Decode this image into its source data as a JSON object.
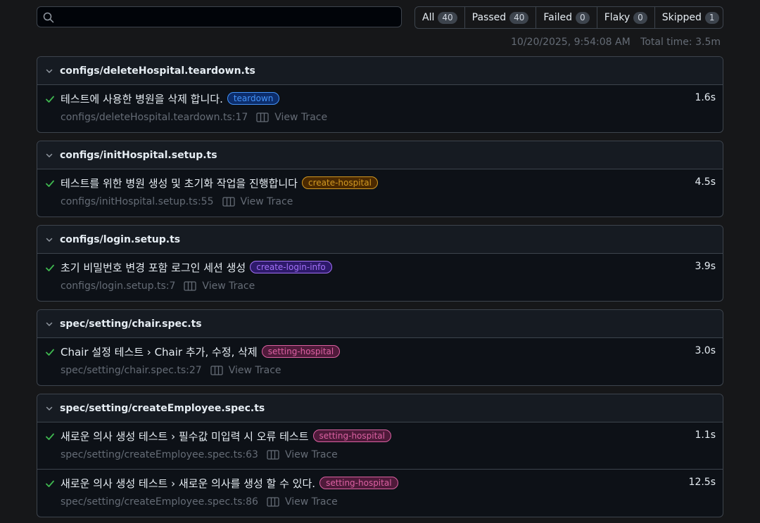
{
  "search": {
    "placeholder": ""
  },
  "filters": [
    {
      "label": "All",
      "count": "40"
    },
    {
      "label": "Passed",
      "count": "40"
    },
    {
      "label": "Failed",
      "count": "0"
    },
    {
      "label": "Flaky",
      "count": "0"
    },
    {
      "label": "Skipped",
      "count": "1"
    }
  ],
  "meta": {
    "datetime": "10/20/2025, 9:54:08 AM",
    "total_time": "Total time: 3.5m"
  },
  "view_trace_label": "View Trace",
  "files": [
    {
      "name": "configs/deleteHospital.teardown.ts",
      "tests": [
        {
          "title": "테스트에 사용한 병원을 삭제 합니다.",
          "label": "teardown",
          "label_color": "#4493f8",
          "label_bg": "#0c2d6b",
          "duration": "1.6s",
          "location": "configs/deleteHospital.teardown.ts:17"
        }
      ]
    },
    {
      "name": "configs/initHospital.setup.ts",
      "tests": [
        {
          "title": "테스트를 위한 병원 생성 및 초기화 작업을 진행합니다",
          "label": "create-hospital",
          "label_color": "#d29922",
          "label_bg": "#4b2900",
          "duration": "4.5s",
          "location": "configs/initHospital.setup.ts:55"
        }
      ]
    },
    {
      "name": "configs/login.setup.ts",
      "tests": [
        {
          "title": "초기 비밀번호 변경 포함 로그인 세션 생성",
          "label": "create-login-info",
          "label_color": "#a371f7",
          "label_bg": "#2e1a6b",
          "duration": "3.9s",
          "location": "configs/login.setup.ts:7"
        }
      ]
    },
    {
      "name": "spec/setting/chair.spec.ts",
      "tests": [
        {
          "title": "Chair 설정 테스트 › Chair 추가, 수정, 삭제",
          "label": "setting-hospital",
          "label_color": "#db61a2",
          "label_bg": "#4f1a3a",
          "duration": "3.0s",
          "location": "spec/setting/chair.spec.ts:27"
        }
      ]
    },
    {
      "name": "spec/setting/createEmployee.spec.ts",
      "tests": [
        {
          "title": "새로운 의사 생성 테스트 › 필수값 미입력 시 오류 테스트",
          "label": "setting-hospital",
          "label_color": "#db61a2",
          "label_bg": "#4f1a3a",
          "duration": "1.1s",
          "location": "spec/setting/createEmployee.spec.ts:63"
        },
        {
          "title": "새로운 의사 생성 테스트 › 새로운 의사를 생성 할 수 있다.",
          "label": "setting-hospital",
          "label_color": "#db61a2",
          "label_bg": "#4f1a3a",
          "duration": "12.5s",
          "location": "spec/setting/createEmployee.spec.ts:86"
        }
      ]
    }
  ],
  "icons": {
    "search": "search-icon",
    "chevron": "chevron-down-icon",
    "check": "check-icon",
    "trace": "trace-icon"
  },
  "colors": {
    "pass": "#3fb950",
    "background": "#161719"
  }
}
